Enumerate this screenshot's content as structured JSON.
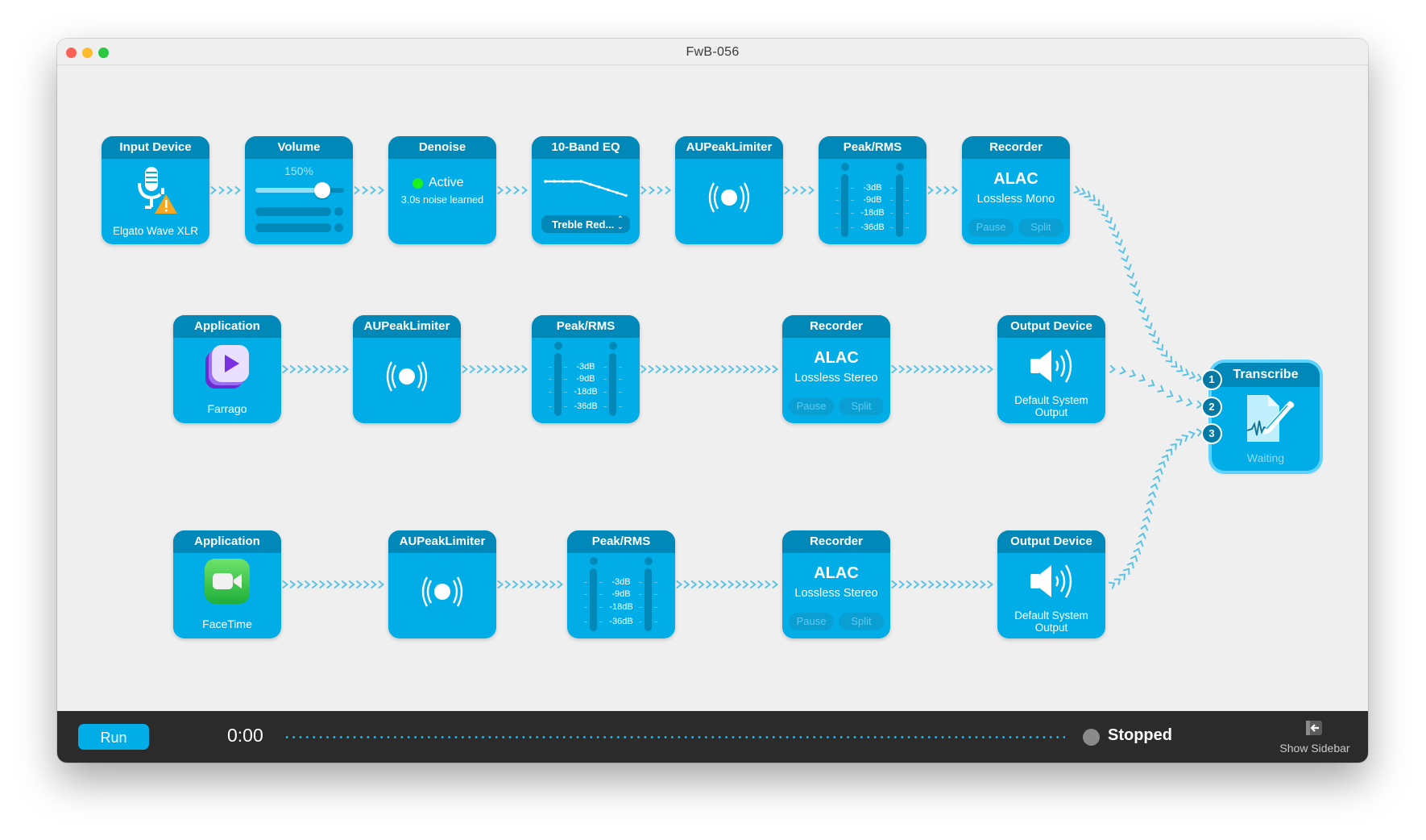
{
  "window": {
    "title": "FwB-056"
  },
  "rows": [
    [
      {
        "type": "Input Device",
        "label": "Elgato Wave XLR",
        "icon": "microphone-warning-icon"
      },
      {
        "type": "Volume",
        "value_label": "150%",
        "slider_value": 0.75
      },
      {
        "type": "Denoise",
        "status": "Active",
        "status_color": "#1ef21e",
        "detail": "3.0s noise learned"
      },
      {
        "type": "10-Band EQ",
        "preset": "Treble Red...",
        "eq_curve": [
          0,
          0,
          0,
          0,
          0,
          -1,
          -2,
          -3,
          -4,
          -5
        ]
      },
      {
        "type": "AUPeakLimiter",
        "icon": "limiter-icon"
      },
      {
        "type": "Peak/RMS",
        "scale": [
          "-3dB",
          "-9dB",
          "-18dB",
          "-36dB"
        ]
      },
      {
        "type": "Recorder",
        "format": "ALAC",
        "mode": "Lossless Mono",
        "pause": "Pause",
        "split": "Split"
      }
    ],
    [
      {
        "type": "Application",
        "label": "Farrago",
        "icon": "farrago-app-icon"
      },
      {
        "type": "AUPeakLimiter",
        "icon": "limiter-icon"
      },
      {
        "type": "Peak/RMS",
        "scale": [
          "-3dB",
          "-9dB",
          "-18dB",
          "-36dB"
        ]
      },
      {
        "type": "Recorder",
        "format": "ALAC",
        "mode": "Lossless Stereo",
        "pause": "Pause",
        "split": "Split"
      },
      {
        "type": "Output Device",
        "label": "Default System Output",
        "icon": "speaker-icon"
      }
    ],
    [
      {
        "type": "Application",
        "label": "FaceTime",
        "icon": "facetime-app-icon"
      },
      {
        "type": "AUPeakLimiter",
        "icon": "limiter-icon"
      },
      {
        "type": "Peak/RMS",
        "scale": [
          "-3dB",
          "-9dB",
          "-18dB",
          "-36dB"
        ]
      },
      {
        "type": "Recorder",
        "format": "ALAC",
        "mode": "Lossless Stereo",
        "pause": "Pause",
        "split": "Split"
      },
      {
        "type": "Output Device",
        "label": "Default System Output",
        "icon": "speaker-icon"
      }
    ]
  ],
  "transcribe": {
    "type": "Transcribe",
    "status": "Waiting",
    "inputs": [
      "1",
      "2",
      "3"
    ]
  },
  "bottom": {
    "run_label": "Run",
    "time": "0:00",
    "status": "Stopped",
    "sidebar_label": "Show Sidebar"
  },
  "colors": {
    "accent": "#00ade6",
    "header": "#0089b8",
    "link": "#5bc3e6"
  }
}
